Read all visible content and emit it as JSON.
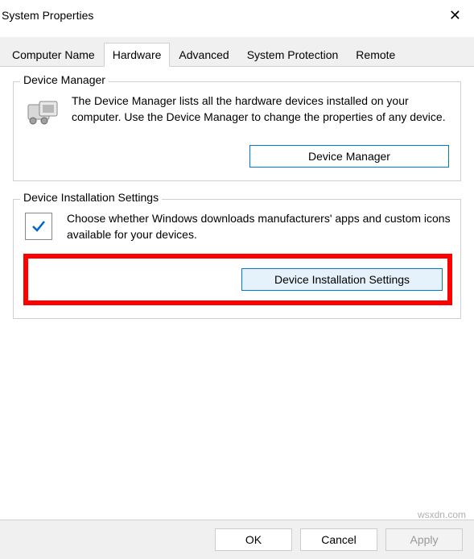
{
  "window": {
    "title": "System Properties"
  },
  "tabs": {
    "computer_name": "Computer Name",
    "hardware": "Hardware",
    "advanced": "Advanced",
    "system_protection": "System Protection",
    "remote": "Remote"
  },
  "group1": {
    "title": "Device Manager",
    "description": "The Device Manager lists all the hardware devices installed on your computer. Use the Device Manager to change the properties of any device.",
    "button": "Device Manager"
  },
  "group2": {
    "title": "Device Installation Settings",
    "description": "Choose whether Windows downloads manufacturers' apps and custom icons available for your devices.",
    "button": "Device Installation Settings"
  },
  "footer": {
    "ok": "OK",
    "cancel": "Cancel",
    "apply": "Apply"
  },
  "watermark": "wsxdn.com"
}
